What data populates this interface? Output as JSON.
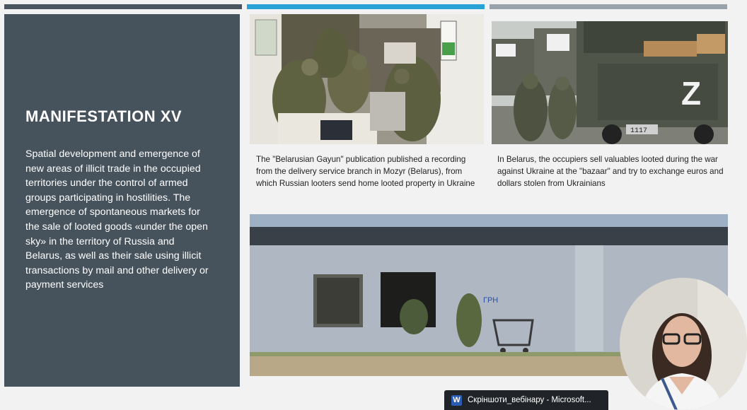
{
  "slide": {
    "title": "MANIFESTATION XV",
    "body": "Spatial development and emergence of new areas of illicit trade in the occupied territories under the control of armed groups participating in hostilities. The emergence of spontaneous markets for the sale of looted goods «under the open sky» in the territory of Russia and Belarus, as well as their sale using illicit transactions by mail and other delivery or payment services",
    "captions": {
      "post_office": "The \"Belarusian Gayun\" publication published a recording from the delivery service branch in Mozyr (Belarus), from which Russian looters send home looted property in Ukraine",
      "trucks": "In Belarus, the occupiers sell valuables looted during the war against Ukraine at the \"bazaar\" and try to exchange euros and dollars stolen from Ukrainians"
    },
    "graffiti_text": "ГРН",
    "truck_plate": "1117"
  },
  "taskbar": {
    "item_label": "Скріншоти_вебінару - Microsoft...",
    "icon": "word-icon"
  },
  "colors": {
    "panel": "#46525c",
    "accent_blue": "#29a3d6",
    "bar_gray": "#9aa2aa"
  }
}
